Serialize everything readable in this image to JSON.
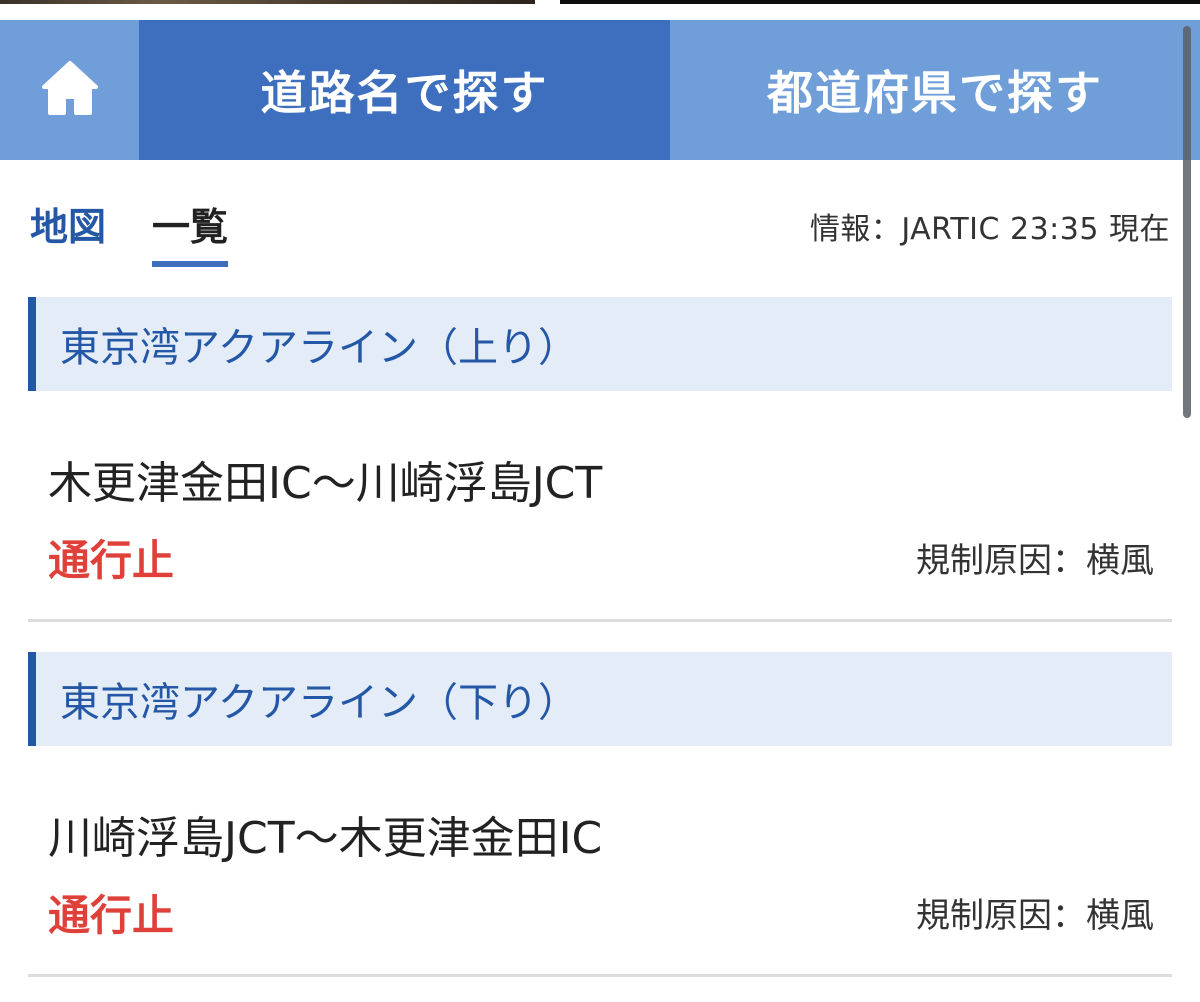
{
  "navbar": {
    "home_icon": "home-icon",
    "tabs": [
      {
        "label": "道路名で探す",
        "active": true
      },
      {
        "label": "都道府県で探す",
        "active": false
      }
    ],
    "active_color": "#3e6fbf",
    "inactive_color": "#6f9ed9"
  },
  "view_switch": {
    "map_label": "地図",
    "list_label": "一覧",
    "selected": "一覧"
  },
  "info": {
    "text": "情報：JARTIC 23:35 現在"
  },
  "sections": [
    {
      "title": "東京湾アクアライン（上り）",
      "route": "木更津金田IC〜川崎浮島JCT",
      "status": "通行止",
      "reason": "規制原因：横風"
    },
    {
      "title": "東京湾アクアライン（下り）",
      "route": "川崎浮島JCT〜木更津金田IC",
      "status": "通行止",
      "reason": "規制原因：横風"
    }
  ],
  "colors": {
    "status_closed": "#e0403a",
    "section_accent": "#2457a6",
    "section_bg": "#e3ecf7"
  }
}
